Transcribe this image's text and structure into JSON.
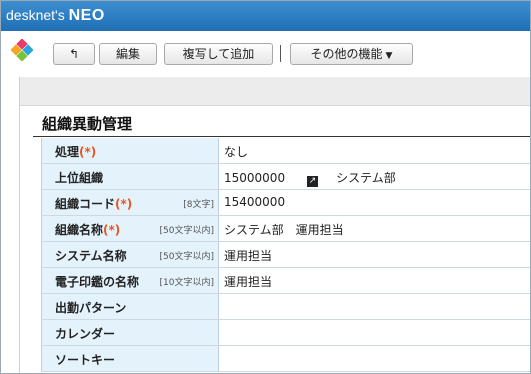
{
  "app": {
    "brand_prefix": "desknet's",
    "brand_name": "NEO"
  },
  "toolbar": {
    "back_icon": "↰",
    "edit_label": "編集",
    "copy_label": "複写して追加",
    "separator": "|",
    "other_label": "その他の機能",
    "other_caret": "▼"
  },
  "page": {
    "title": "組織異動管理"
  },
  "form": {
    "rows": [
      {
        "label": "処理",
        "required": "(*)",
        "limit": "",
        "value": "なし"
      },
      {
        "label": "上位組織",
        "required": "",
        "limit": "",
        "value_code": "15000000",
        "value_name": "システム部"
      },
      {
        "label": "組織コード",
        "required": "(*)",
        "limit": "[8文字]",
        "value": "15400000"
      },
      {
        "label": "組織名称",
        "required": "(*)",
        "limit": "[50文字以内]",
        "value": "システム部　運用担当"
      },
      {
        "label": "システム名称",
        "required": "",
        "limit": "[50文字以内]",
        "value": "運用担当"
      },
      {
        "label": "電子印鑑の名称",
        "required": "",
        "limit": "[10文字以内]",
        "value": "運用担当"
      },
      {
        "label": "出勤パターン",
        "required": "",
        "limit": "",
        "value": ""
      },
      {
        "label": "カレンダー",
        "required": "",
        "limit": "",
        "value": ""
      },
      {
        "label": "ソートキー",
        "required": "",
        "limit": "",
        "value": ""
      }
    ]
  },
  "icons": {
    "app_logo": "flower-logo-icon",
    "link": "external-link-icon"
  },
  "colors": {
    "titlebar": "#2a7dc4",
    "label_bg": "#e3f2fb",
    "required": "#e8541e"
  }
}
